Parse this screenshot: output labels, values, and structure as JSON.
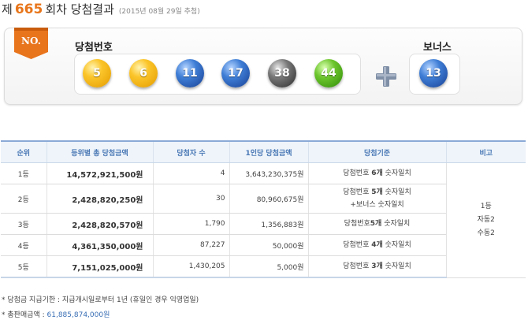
{
  "header": {
    "prefix": "제",
    "round": "665",
    "suffix": "회차 당첨결과",
    "date": "(2015년 08월 29일 추첨)"
  },
  "badge": {
    "label": "NO.",
    "color": "#e8741c"
  },
  "winning": {
    "label": "당첨번호",
    "numbers": [
      "5",
      "6",
      "11",
      "17",
      "38",
      "44"
    ],
    "colors": [
      "yellow",
      "yellow",
      "blue",
      "blue",
      "gray",
      "green"
    ]
  },
  "bonus": {
    "label": "보너스",
    "number": "13",
    "color": "blue"
  },
  "table": {
    "headers": [
      "순위",
      "등위별 총 당첨금액",
      "당첨자 수",
      "1인당 당첨금액",
      "당첨기준",
      "비고"
    ],
    "rows": [
      {
        "rank": "1등",
        "total": "14,572,921,500원",
        "winners": "4",
        "per": "3,643,230,375원",
        "crit_a": "당첨번호 ",
        "crit_b": "6개",
        "crit_c": " 숫자일치",
        "crit_d": ""
      },
      {
        "rank": "2등",
        "total": "2,428,820,250원",
        "winners": "30",
        "per": "80,960,675원",
        "crit_a": "당첨번호 ",
        "crit_b": "5개",
        "crit_c": " 숫자일치",
        "crit_d": "+보너스 숫자일치"
      },
      {
        "rank": "3등",
        "total": "2,428,820,570원",
        "winners": "1,790",
        "per": "1,356,883원",
        "crit_a": "당첨번호",
        "crit_b": "5개",
        "crit_c": " 숫자일치",
        "crit_d": ""
      },
      {
        "rank": "4등",
        "total": "4,361,350,000원",
        "winners": "87,227",
        "per": "50,000원",
        "crit_a": "당첨번호 ",
        "crit_b": "4개",
        "crit_c": " 숫자일치",
        "crit_d": ""
      },
      {
        "rank": "5등",
        "total": "7,151,025,000원",
        "winners": "1,430,205",
        "per": "5,000원",
        "crit_a": "당첨번호 ",
        "crit_b": "3개",
        "crit_c": " 숫자일치",
        "crit_d": ""
      }
    ],
    "note": [
      "1등",
      "자동2",
      "수동2"
    ]
  },
  "footer": {
    "line1": "* 당첨금 지급기한 : 지급개시일로부터 1년 (휴일인 경우 익영업일)",
    "line2_label": "* 총판매금액 : ",
    "line2_value": "61,885,874,000원"
  }
}
